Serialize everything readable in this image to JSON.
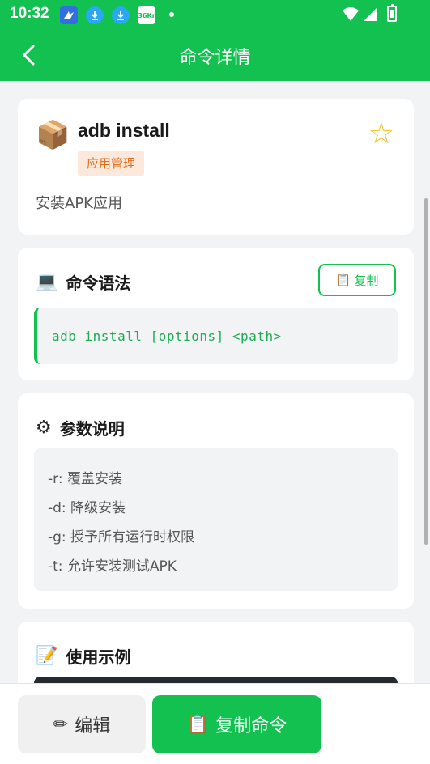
{
  "status_bar": {
    "time": "10:32",
    "icons": [
      "bird-icon",
      "download-icon",
      "download-icon",
      "36kr-icon"
    ],
    "kr_label": "36Kr"
  },
  "app_bar": {
    "title": "命令详情"
  },
  "command_card": {
    "emoji": "📦",
    "name": "adb install",
    "category": "应用管理",
    "description": "安装APK应用",
    "favorite": false
  },
  "syntax": {
    "emoji": "💻",
    "label": "命令语法",
    "copy_label": "复制",
    "copy_emoji": "📋",
    "code": "adb install [options] <path>"
  },
  "params": {
    "emoji": "⚙",
    "label": "参数说明",
    "items": [
      "-r: 覆盖安装",
      "-d: 降级安装",
      "-g: 授予所有运行时权限",
      "-t: 允许安装测试APK"
    ]
  },
  "examples": {
    "emoji": "📝",
    "label": "使用示例"
  },
  "bottom": {
    "edit_label": "编辑",
    "edit_emoji": "✏",
    "copy_label": "复制命令",
    "copy_emoji": "📋"
  },
  "colors": {
    "primary": "#12c14f",
    "tag_bg": "#fde8dc",
    "tag_text": "#e06d1c",
    "star": "#f4c21a"
  }
}
